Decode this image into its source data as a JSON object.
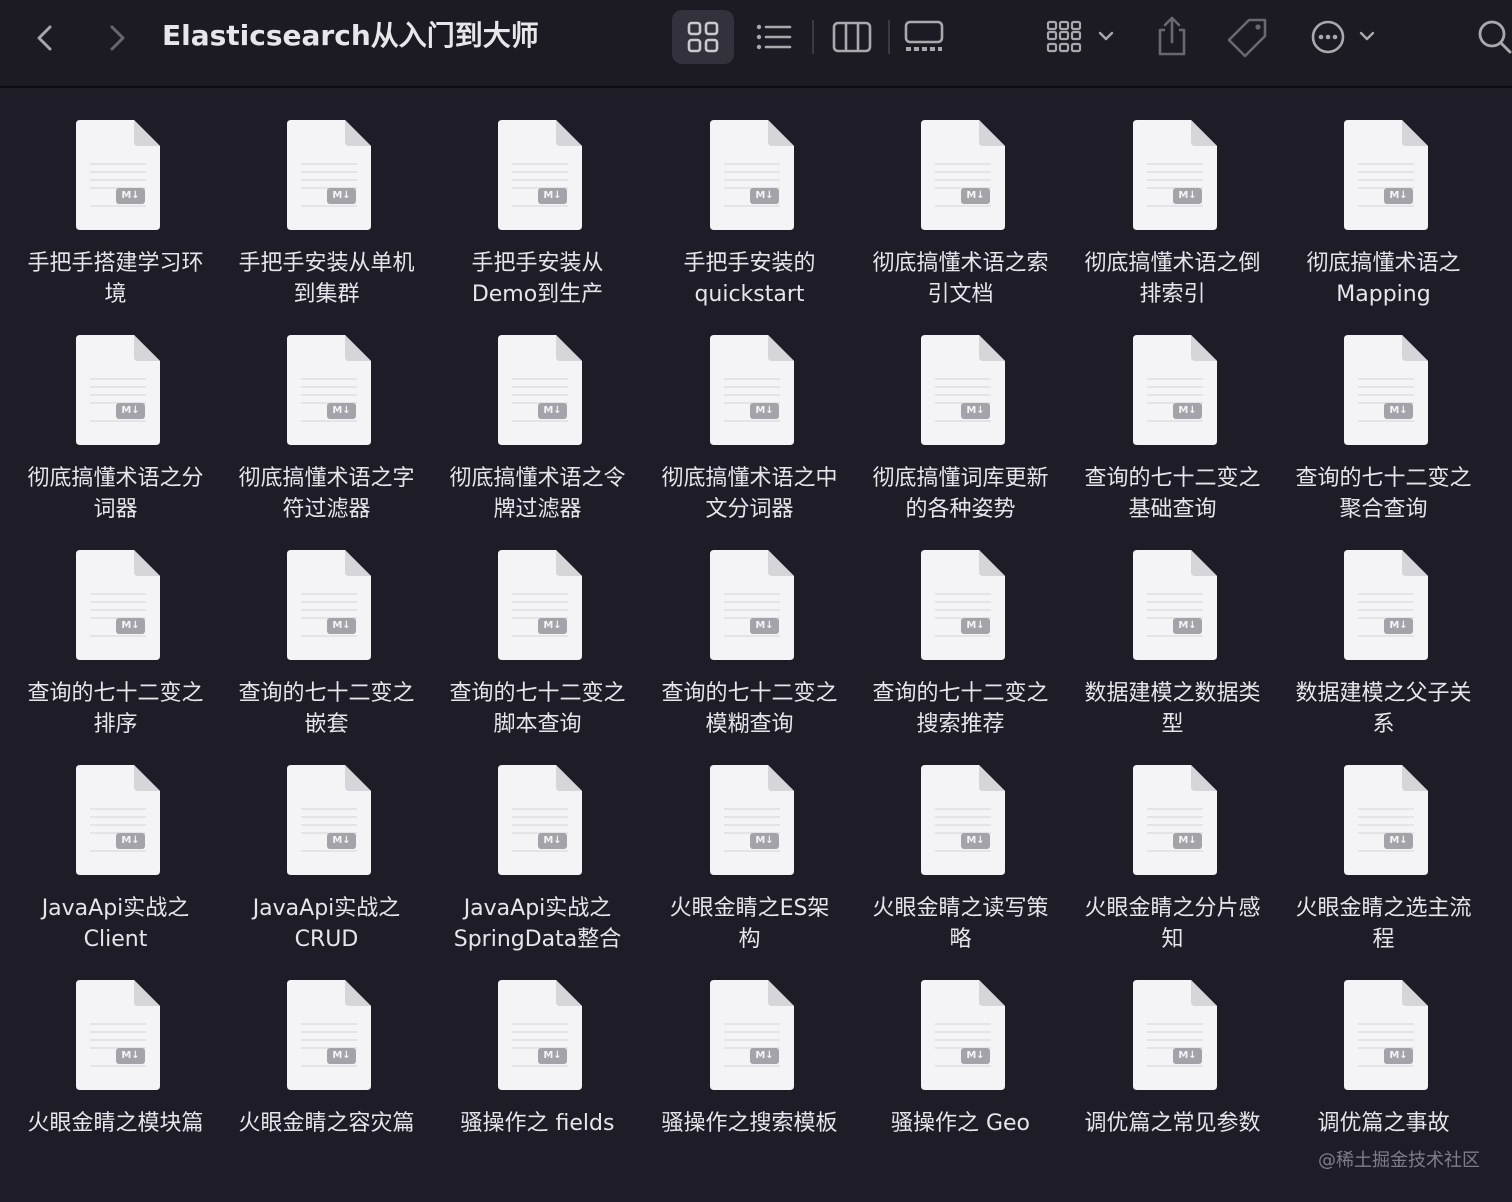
{
  "window": {
    "title": "Elasticsearch从入门到大师"
  },
  "toolbar": {
    "back_icon": "chevron-left-icon",
    "forward_icon": "chevron-right-icon",
    "view_modes": [
      "icon-view",
      "list-view",
      "column-view",
      "gallery-view"
    ],
    "active_view": "icon-view",
    "group_icon": "group-by-icon",
    "share_icon": "share-icon",
    "tag_icon": "tag-icon",
    "more_icon": "more-icon",
    "search_icon": "search-icon"
  },
  "file_badge": "M↓",
  "files": [
    {
      "line1": "手把手搭建学习环",
      "line2": "境"
    },
    {
      "line1": "手把手安装从单机",
      "line2": "到集群"
    },
    {
      "line1": "手把手安装从",
      "line2": "Demo到生产"
    },
    {
      "line1": "手把手安装的",
      "line2": "quickstart"
    },
    {
      "line1": "彻底搞懂术语之索",
      "line2": "引文档"
    },
    {
      "line1": "彻底搞懂术语之倒",
      "line2": "排索引"
    },
    {
      "line1": "彻底搞懂术语之",
      "line2": "Mapping"
    },
    {
      "line1": "彻底搞懂术语之分",
      "line2": "词器"
    },
    {
      "line1": "彻底搞懂术语之字",
      "line2": "符过滤器"
    },
    {
      "line1": "彻底搞懂术语之令",
      "line2": "牌过滤器"
    },
    {
      "line1": "彻底搞懂术语之中",
      "line2": "文分词器"
    },
    {
      "line1": "彻底搞懂词库更新",
      "line2": "的各种姿势"
    },
    {
      "line1": "查询的七十二变之",
      "line2": "基础查询"
    },
    {
      "line1": "查询的七十二变之",
      "line2": "聚合查询"
    },
    {
      "line1": "查询的七十二变之",
      "line2": "排序"
    },
    {
      "line1": "查询的七十二变之",
      "line2": "嵌套"
    },
    {
      "line1": "查询的七十二变之",
      "line2": "脚本查询"
    },
    {
      "line1": "查询的七十二变之",
      "line2": "模糊查询"
    },
    {
      "line1": "查询的七十二变之",
      "line2": "搜索推荐"
    },
    {
      "line1": "数据建模之数据类",
      "line2": "型"
    },
    {
      "line1": "数据建模之父子关",
      "line2": "系"
    },
    {
      "line1": "JavaApi实战之",
      "line2": "Client"
    },
    {
      "line1": "JavaApi实战之",
      "line2": "CRUD"
    },
    {
      "line1": "JavaApi实战之",
      "line2": "SpringData整合"
    },
    {
      "line1": "火眼金睛之ES架",
      "line2": "构"
    },
    {
      "line1": "火眼金睛之读写策",
      "line2": "略"
    },
    {
      "line1": "火眼金睛之分片感",
      "line2": "知"
    },
    {
      "line1": "火眼金睛之选主流",
      "line2": "程"
    },
    {
      "line1": "火眼金睛之模块篇",
      "line2": ""
    },
    {
      "line1": "火眼金睛之容灾篇",
      "line2": ""
    },
    {
      "line1": "骚操作之 fields",
      "line2": ""
    },
    {
      "line1": "骚操作之搜索模板",
      "line2": ""
    },
    {
      "line1": "骚操作之 Geo",
      "line2": ""
    },
    {
      "line1": "调优篇之常见参数",
      "line2": ""
    },
    {
      "line1": "调优篇之事故",
      "line2": ""
    }
  ],
  "watermark": "@稀土掘金技术社区"
}
